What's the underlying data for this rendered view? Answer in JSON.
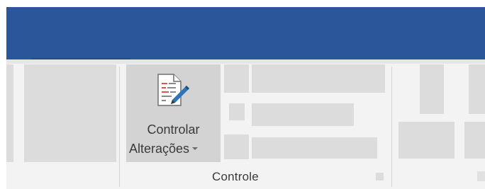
{
  "ribbon": {
    "track_changes": {
      "line1": "Controlar",
      "line2": "Alterações"
    },
    "group_label": "Controle"
  },
  "icons": {
    "track_changes": "document-pen-icon",
    "dropdown": "chevron-down-icon",
    "dialog_launcher": "dialog-launcher-icon"
  },
  "colors": {
    "title_bar": "#2b579a",
    "ribbon_background": "#f3f3f3",
    "button_hover": "#d3d3d3"
  }
}
